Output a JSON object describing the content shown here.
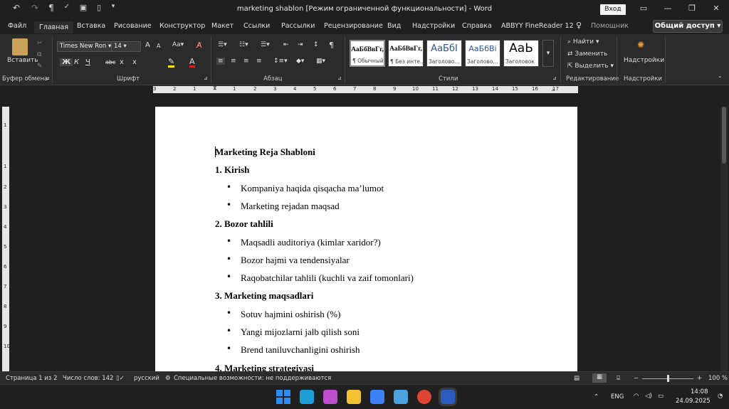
{
  "window": {
    "title": "marketing shablon [Режим ограниченной функциональности]  -  Word",
    "signin": "Вход"
  },
  "quick_access": [
    "undo-icon",
    "redo-icon",
    "pilcrow-icon",
    "spelling-icon",
    "save-icon",
    "new-doc-icon",
    "customize-icon"
  ],
  "tabs": [
    "Файл",
    "Главная",
    "Вставка",
    "Рисование",
    "Конструктор",
    "Макет",
    "Ссылки",
    "Рассылки",
    "Рецензирование",
    "Вид",
    "Надстройки",
    "Справка",
    "ABBYY FineReader 12"
  ],
  "tell_me": "Помощник",
  "share": "Общий доступ",
  "ribbon": {
    "clipboard": {
      "paste": "Вставить",
      "label": "Буфер обмена"
    },
    "font": {
      "name": "Times New Ron",
      "size": "14",
      "label": "Шрифт",
      "bold": "Ж",
      "italic": "К",
      "underline": "Ч",
      "strike": "abc"
    },
    "paragraph": {
      "label": "Абзац"
    },
    "styles": {
      "label": "Стили",
      "items": [
        {
          "sample": "АаБбВвГг,",
          "name": "¶ Обычный"
        },
        {
          "sample": "АаБбВвГг,",
          "name": "¶ Без инте..."
        },
        {
          "sample": "АаБбІ",
          "name": "Заголово..."
        },
        {
          "sample": "АаБбВі",
          "name": "Заголово..."
        },
        {
          "sample": "АаЬ",
          "name": "Заголовок"
        }
      ]
    },
    "editing": {
      "find": "Найти",
      "replace": "Заменить",
      "select": "Выделить",
      "label": "Редактирование"
    },
    "addins": {
      "button": "Надстройки",
      "label": "Надстройки"
    }
  },
  "ruler": {
    "h_numbers": [
      "3",
      "2",
      "1",
      "1",
      "2",
      "3",
      "4",
      "5",
      "6",
      "7",
      "8",
      "9",
      "10",
      "11",
      "12",
      "13",
      "14",
      "15",
      "16",
      "17"
    ],
    "v_numbers": [
      "2",
      "1",
      "1",
      "2",
      "3",
      "4",
      "5",
      "6",
      "7",
      "8",
      "9",
      "10"
    ]
  },
  "document": {
    "lines": [
      {
        "text": "Marketing Reja Shabloni",
        "type": "heading"
      },
      {
        "text": "1. Kirish",
        "type": "heading"
      },
      {
        "text": "Kompaniya haqida qisqacha ma’lumot",
        "type": "bullet"
      },
      {
        "text": "Marketing rejadan maqsad",
        "type": "bullet"
      },
      {
        "text": "2. Bozor tahlili",
        "type": "heading"
      },
      {
        "text": "Maqsadli auditoriya (kimlar xaridor?)",
        "type": "bullet"
      },
      {
        "text": "Bozor hajmi va tendensiyalar",
        "type": "bullet"
      },
      {
        "text": "Raqobatchilar tahlili (kuchli va zaif tomonlari)",
        "type": "bullet"
      },
      {
        "text": "3. Marketing maqsadlari",
        "type": "heading"
      },
      {
        "text": "Sotuv hajmini oshirish (%)",
        "type": "bullet"
      },
      {
        "text": "Yangi mijozlarni jalb qilish soni",
        "type": "bullet"
      },
      {
        "text": "Brend taniluvchanligini oshirish",
        "type": "bullet"
      },
      {
        "text": "4. Marketing strategiyasi",
        "type": "heading"
      }
    ]
  },
  "status": {
    "page": "Страница 1 из 2",
    "words": "Число слов: 142",
    "language": "русский",
    "accessibility": "Специальные возможности: не поддерживаются",
    "zoom": "100 %",
    "zoom_level": 100
  },
  "taskbar": {
    "lang": "ENG",
    "time": "14:08",
    "date": "24.09.2025",
    "apps": [
      {
        "name": "windows-start-icon",
        "color": "#2f8cf0"
      },
      {
        "name": "edge-icon",
        "color": "#1f9fd8"
      },
      {
        "name": "copilot-icon",
        "color": "#c04fd0"
      },
      {
        "name": "file-explorer-icon",
        "color": "#f2c232"
      },
      {
        "name": "store-icon",
        "color": "#3b82f6"
      },
      {
        "name": "photos-icon",
        "color": "#4aa3df"
      },
      {
        "name": "chrome-icon",
        "color": "#e04434"
      },
      {
        "name": "word-icon",
        "color": "#2b5bbf"
      }
    ]
  }
}
